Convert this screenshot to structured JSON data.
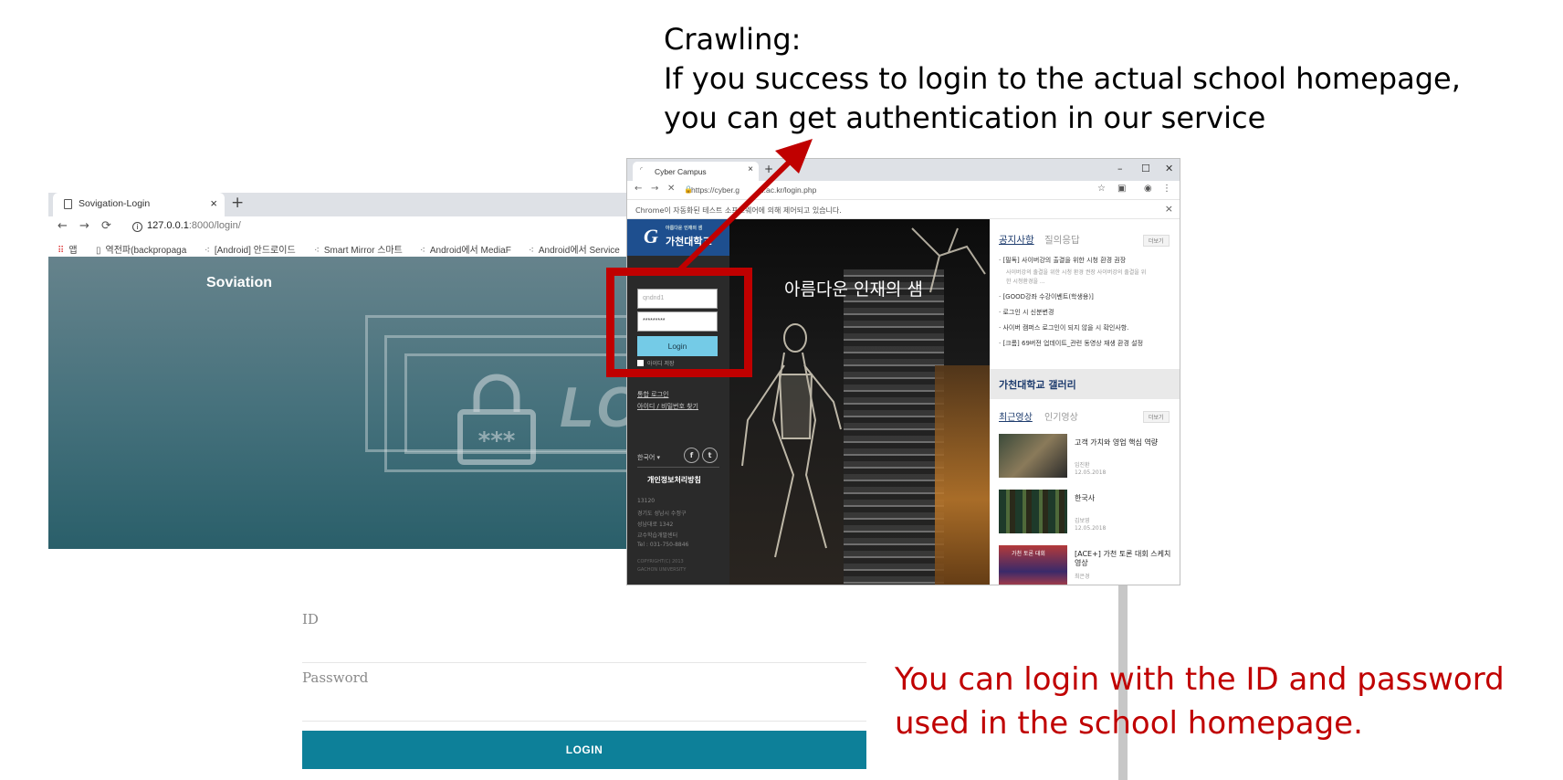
{
  "annotation": {
    "crawl_title": "Crawling:",
    "crawl_line1": "If you success to login to the actual school homepage,",
    "crawl_line2": "you can get authentication in our service",
    "note_line1": "You can login with the ID and password",
    "note_line2": "used in the school homepage.",
    "accent_color": "#c00000"
  },
  "soviation_window": {
    "tab_title": "Sovigation-Login",
    "tab_close": "×",
    "new_tab": "+",
    "url": "127.0.0.1:8000/login/",
    "url_host": "127.0.0.1",
    "url_path": ":8000/login/",
    "bookmarks": [
      {
        "icon": "apps-grid-icon",
        "label": "앱"
      },
      {
        "icon": "page-icon",
        "label": "역전파(backpropaga"
      },
      {
        "icon": "tistory-icon",
        "label": "[Android] 안드로이드"
      },
      {
        "icon": "tistory-icon",
        "label": "Smart Mirror 스마트"
      },
      {
        "icon": "tistory-icon",
        "label": "Android에서 MediaF"
      },
      {
        "icon": "tistory-icon",
        "label": "Android에서 Service"
      }
    ],
    "brand": "Soviation",
    "hero_text": "LOG",
    "lock_text": "***",
    "form": {
      "id_placeholder": "ID",
      "password_placeholder": "Password",
      "login_button": "LOGIN"
    }
  },
  "campus_window": {
    "tab_title": "Cyber Campus",
    "tab_close": "×",
    "new_tab": "+",
    "window_controls": [
      "–",
      "☐",
      "✕"
    ],
    "url_visible_start": "https://cyber.g",
    "url_visible_end": "n.ac.kr/login.php",
    "infobar_text": "Chrome이 자동화된 테스트 소프트웨어에 의해 제어되고 있습니다.",
    "infobar_close": "×",
    "logo_small": "아름다운 인재의 샘",
    "logo_name": "가천대학교",
    "sidebar": {
      "login_label": "LOGIN",
      "id_value": "qndnd1",
      "password_value": "*********",
      "login_button": "Login",
      "save_id": "아이디 저장",
      "link_integrated": "통합 로그인",
      "link_find": "아이디 / 비밀번호 찾기",
      "language": "한국어 ▾",
      "social": [
        "f",
        "t"
      ],
      "privacy": "개인정보처리방침",
      "address_lines": [
        "13120",
        "경기도 성남시 수정구",
        "성남대로 1342",
        "교수학습개발센터",
        "Tel : 031-750-8846"
      ],
      "copyright_lines": [
        "COPYRIGHT(C) 2013",
        "GACHON UNIVERSITY"
      ]
    },
    "slogan": "아름다운 인재의 샘",
    "notice_tabs": [
      "공지사항",
      "질의응답"
    ],
    "more_label": "더보기",
    "notices": [
      "· [필독] 사이버강의 출결을 위한 시청 환경 권장",
      "사이버강의 출결을 위한 시청 환경 권장 사이버강의 출결을 위",
      "한 시청환경을 ...",
      "· [GOOD강좌 수강이벤트(학생용)]",
      "· 로그인 시 신분변경",
      "· 사이버 캠퍼스 로그인이 되지 않을 시 확인사항.",
      "· [크롬] 69버전 업데이트_관련 동영상 재생 환경 설정"
    ],
    "gallery_title": "가천대학교 갤러리",
    "video_tabs": [
      "최근영상",
      "인기영상"
    ],
    "videos": [
      {
        "title": "고객 가치와 영업 핵심 역량",
        "author": "임진환",
        "date": "12.05.2018"
      },
      {
        "title": "한국사",
        "author": "김보영",
        "date": "12.05.2018"
      },
      {
        "title": "[ACE+] 가천 토론 대회 스케치 영상",
        "author": "최은경",
        "date": ""
      }
    ],
    "video3_thumb_caption": "가천 토론 대회"
  }
}
